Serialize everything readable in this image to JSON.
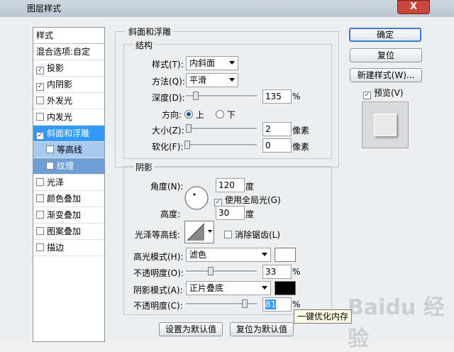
{
  "window": {
    "title": "图层样式",
    "close": "X"
  },
  "sidebar": {
    "header": "样式",
    "blend": "混合选项:自定",
    "items": [
      {
        "label": "投影",
        "checked": true
      },
      {
        "label": "内阴影",
        "checked": true
      },
      {
        "label": "外发光",
        "checked": false
      },
      {
        "label": "内发光",
        "checked": false
      },
      {
        "label": "斜面和浮雕",
        "checked": true,
        "selected": true
      },
      {
        "label": "等高线",
        "checked": false,
        "sub": true
      },
      {
        "label": "纹理",
        "checked": false,
        "sub": true
      },
      {
        "label": "光泽",
        "checked": false
      },
      {
        "label": "颜色叠加",
        "checked": false
      },
      {
        "label": "渐变叠加",
        "checked": false
      },
      {
        "label": "图案叠加",
        "checked": false
      },
      {
        "label": "描边",
        "checked": false
      }
    ]
  },
  "bevel": {
    "section_title": "斜面和浮雕",
    "structure_title": "结构",
    "style_label": "样式(T):",
    "style_value": "内斜面",
    "technique_label": "方法(Q):",
    "technique_value": "平滑",
    "depth_label": "深度(D):",
    "depth_value": "135",
    "depth_unit": "%",
    "direction_label": "方向:",
    "dir_up": "上",
    "dir_down": "下",
    "size_label": "大小(Z):",
    "size_value": "2",
    "size_unit": "像素",
    "soften_label": "软化(F):",
    "soften_value": "0",
    "soften_unit": "像素"
  },
  "shading": {
    "title": "阴影",
    "angle_label": "角度(N):",
    "angle_value": "120",
    "angle_unit": "度",
    "global_light": "使用全局光(G)",
    "altitude_label": "高度:",
    "altitude_value": "30",
    "altitude_unit": "度",
    "gloss_label": "光泽等高线:",
    "antialias": "消除锯齿(L)",
    "highlight_label": "高光模式(H):",
    "highlight_value": "滤色",
    "hl_opacity_label": "不透明度(O):",
    "hl_opacity_value": "33",
    "hl_opacity_unit": "%",
    "shadow_label": "阴影模式(A):",
    "shadow_value": "正片叠底",
    "sh_opacity_label": "不透明度(C):",
    "sh_opacity_value": "81",
    "sh_opacity_unit": "%"
  },
  "buttons": {
    "ok": "确定",
    "reset": "复位",
    "new_style": "新建样式(W)...",
    "preview": "预览(V)",
    "make_default": "设置为默认值",
    "reset_default": "复位为默认值"
  },
  "tooltip": "一键优化内存",
  "watermark": "Baidu 经验",
  "colors": {
    "highlight": "#ffffff",
    "shadow": "#000000",
    "selection": "#3399ff"
  }
}
